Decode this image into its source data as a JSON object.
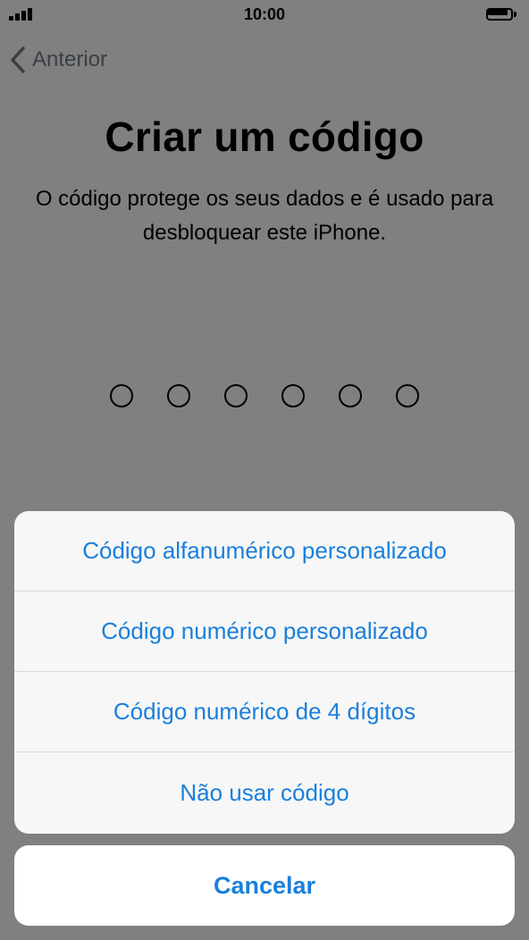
{
  "status_bar": {
    "time": "10:00"
  },
  "nav": {
    "back_label": "Anterior"
  },
  "main": {
    "title": "Criar um código",
    "subtitle": "O código protege os seus dados e é usado para desbloquear este iPhone."
  },
  "passcode": {
    "slots": 6,
    "filled": 0
  },
  "action_sheet": {
    "options": [
      {
        "label": "Código alfanumérico personalizado"
      },
      {
        "label": "Código numérico personalizado"
      },
      {
        "label": "Código numérico de 4 dígitos"
      },
      {
        "label": "Não usar código"
      }
    ],
    "cancel_label": "Cancelar"
  },
  "colors": {
    "accent": "#1a7fdc",
    "overlay": "#808080"
  }
}
